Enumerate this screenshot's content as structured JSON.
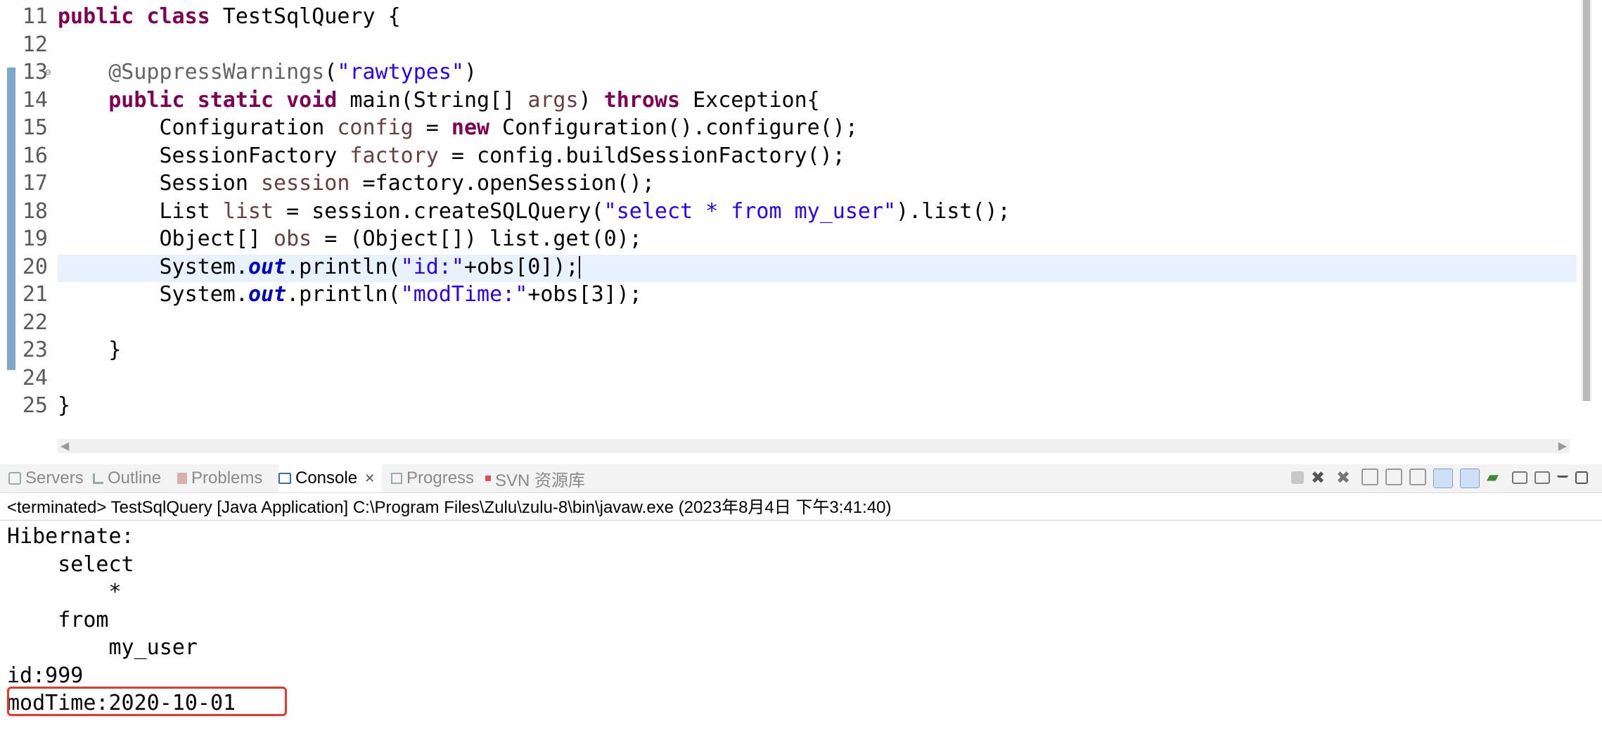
{
  "editor": {
    "lines": [
      {
        "num": "11",
        "code": "public class TestSqlQuery {"
      },
      {
        "num": "12",
        "code": ""
      },
      {
        "num": "13",
        "code": "    @SuppressWarnings(\"rawtypes\")"
      },
      {
        "num": "14",
        "code": "    public static void main(String[] args) throws Exception{"
      },
      {
        "num": "15",
        "code": "        Configuration config = new Configuration().configure();"
      },
      {
        "num": "16",
        "code": "        SessionFactory factory = config.buildSessionFactory();"
      },
      {
        "num": "17",
        "code": "        Session session =factory.openSession();"
      },
      {
        "num": "18",
        "code": "        List list = session.createSQLQuery(\"select * from my_user\").list();"
      },
      {
        "num": "19",
        "code": "        Object[] obs = (Object[]) list.get(0);"
      },
      {
        "num": "20",
        "code": "        System.out.println(\"id:\"+obs[0]);"
      },
      {
        "num": "21",
        "code": "        System.out.println(\"modTime:\"+obs[3]);"
      },
      {
        "num": "22",
        "code": ""
      },
      {
        "num": "23",
        "code": "    }"
      },
      {
        "num": "24",
        "code": ""
      },
      {
        "num": "25",
        "code": "}"
      }
    ],
    "current_line": "20"
  },
  "views": {
    "tabs": [
      {
        "label": "Servers",
        "icon": "servers-icon",
        "color": "#8a8a8a"
      },
      {
        "label": "Outline",
        "icon": "outline-icon",
        "color": "#8a8a8a"
      },
      {
        "label": "Problems",
        "icon": "problems-icon",
        "color": "#8a8a8a"
      },
      {
        "label": "Console",
        "icon": "console-icon",
        "color": "#000000",
        "active": true
      },
      {
        "label": "Progress",
        "icon": "progress-icon",
        "color": "#8a8a8a"
      },
      {
        "label": "SVN 资源库",
        "icon": "svn-icon",
        "color": "#8a8a8a"
      }
    ],
    "close_glyph": "✕",
    "toolbar_icons": [
      "terminate-icon",
      "remove-launch-icon",
      "remove-all-icon",
      "clear-console-icon",
      "scroll-lock-icon",
      "word-wrap-icon",
      "show-stdout-icon",
      "show-stderr-icon",
      "pin-console-icon",
      "display-console-icon",
      "open-console-icon",
      "minimize-icon",
      "maximize-icon"
    ]
  },
  "console": {
    "process_line": "<terminated> TestSqlQuery [Java Application] C:\\Program Files\\Zulu\\zulu-8\\bin\\javaw.exe (2023年8月4日 下午3:41:40)",
    "output": [
      "Hibernate:",
      "    select",
      "        *",
      "    from",
      "        my_user",
      "id:999",
      "modTime:2020-10-01"
    ],
    "highlighted_line_index": 6,
    "highlight_color": "#e8382a"
  }
}
